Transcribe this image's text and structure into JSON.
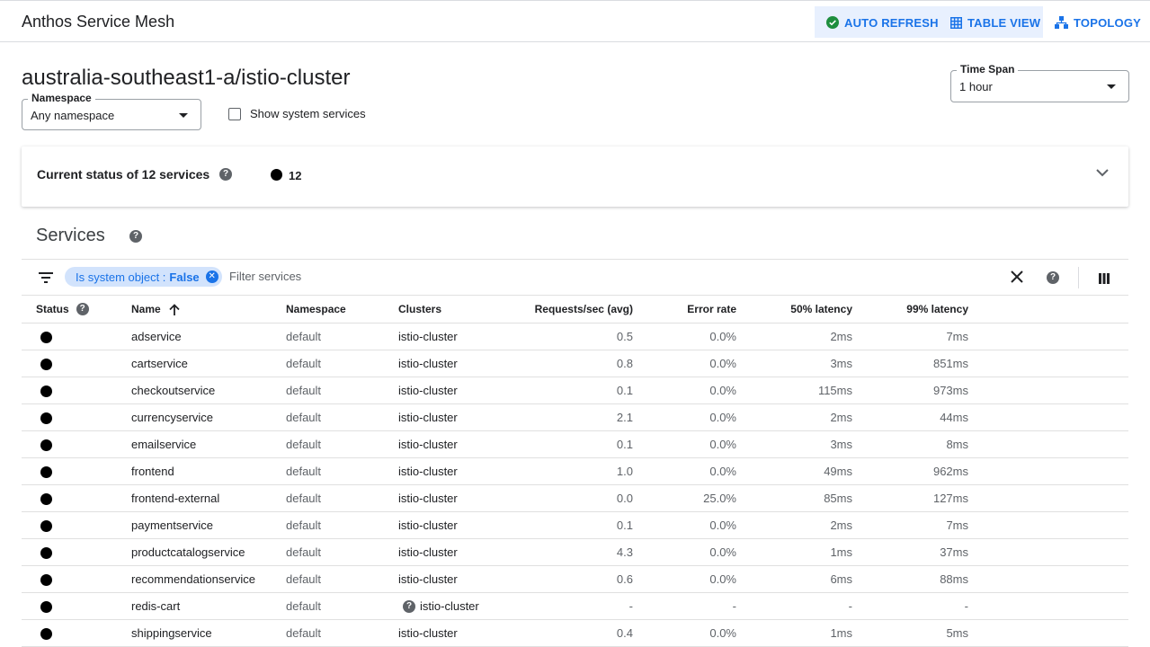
{
  "app": {
    "title": "Anthos Service Mesh"
  },
  "toolbar": {
    "auto_refresh_label": "AUTO REFRESH",
    "table_view_label": "TABLE VIEW",
    "topology_label": "TOPOLOGY",
    "accent_color": "#1a73e8",
    "success_color": "#1e8e3e"
  },
  "page": {
    "heading": "australia-southeast1-a/istio-cluster"
  },
  "namespace": {
    "label": "Namespace",
    "value": "Any namespace"
  },
  "system_services": {
    "label": "Show system services",
    "checked": false
  },
  "time_span": {
    "label": "Time Span",
    "value": "1 hour"
  },
  "status_card": {
    "title": "Current status of 12 services",
    "count": "12"
  },
  "services": {
    "title": "Services",
    "filter_chip_key": "Is system object :",
    "filter_chip_value": "False",
    "filter_placeholder": "Filter services",
    "columns": {
      "status": "Status",
      "name": "Name",
      "namespace": "Namespace",
      "clusters": "Clusters",
      "requests": "Requests/sec (avg)",
      "error_rate": "Error rate",
      "latency50": "50% latency",
      "latency99": "99% latency"
    },
    "rows": [
      {
        "name": "adservice",
        "namespace": "default",
        "cluster": "istio-cluster",
        "cluster_unknown": false,
        "requests": "0.5",
        "error_rate": "0.0%",
        "latency50": "2ms",
        "latency99": "7ms"
      },
      {
        "name": "cartservice",
        "namespace": "default",
        "cluster": "istio-cluster",
        "cluster_unknown": false,
        "requests": "0.8",
        "error_rate": "0.0%",
        "latency50": "3ms",
        "latency99": "851ms"
      },
      {
        "name": "checkoutservice",
        "namespace": "default",
        "cluster": "istio-cluster",
        "cluster_unknown": false,
        "requests": "0.1",
        "error_rate": "0.0%",
        "latency50": "115ms",
        "latency99": "973ms"
      },
      {
        "name": "currencyservice",
        "namespace": "default",
        "cluster": "istio-cluster",
        "cluster_unknown": false,
        "requests": "2.1",
        "error_rate": "0.0%",
        "latency50": "2ms",
        "latency99": "44ms"
      },
      {
        "name": "emailservice",
        "namespace": "default",
        "cluster": "istio-cluster",
        "cluster_unknown": false,
        "requests": "0.1",
        "error_rate": "0.0%",
        "latency50": "3ms",
        "latency99": "8ms"
      },
      {
        "name": "frontend",
        "namespace": "default",
        "cluster": "istio-cluster",
        "cluster_unknown": false,
        "requests": "1.0",
        "error_rate": "0.0%",
        "latency50": "49ms",
        "latency99": "962ms"
      },
      {
        "name": "frontend-external",
        "namespace": "default",
        "cluster": "istio-cluster",
        "cluster_unknown": false,
        "requests": "0.0",
        "error_rate": "25.0%",
        "latency50": "85ms",
        "latency99": "127ms"
      },
      {
        "name": "paymentservice",
        "namespace": "default",
        "cluster": "istio-cluster",
        "cluster_unknown": false,
        "requests": "0.1",
        "error_rate": "0.0%",
        "latency50": "2ms",
        "latency99": "7ms"
      },
      {
        "name": "productcatalogservice",
        "namespace": "default",
        "cluster": "istio-cluster",
        "cluster_unknown": false,
        "requests": "4.3",
        "error_rate": "0.0%",
        "latency50": "1ms",
        "latency99": "37ms"
      },
      {
        "name": "recommendationservice",
        "namespace": "default",
        "cluster": "istio-cluster",
        "cluster_unknown": false,
        "requests": "0.6",
        "error_rate": "0.0%",
        "latency50": "6ms",
        "latency99": "88ms"
      },
      {
        "name": "redis-cart",
        "namespace": "default",
        "cluster": "istio-cluster",
        "cluster_unknown": true,
        "requests": "-",
        "error_rate": "-",
        "latency50": "-",
        "latency99": "-"
      },
      {
        "name": "shippingservice",
        "namespace": "default",
        "cluster": "istio-cluster",
        "cluster_unknown": false,
        "requests": "0.4",
        "error_rate": "0.0%",
        "latency50": "1ms",
        "latency99": "5ms"
      }
    ]
  }
}
